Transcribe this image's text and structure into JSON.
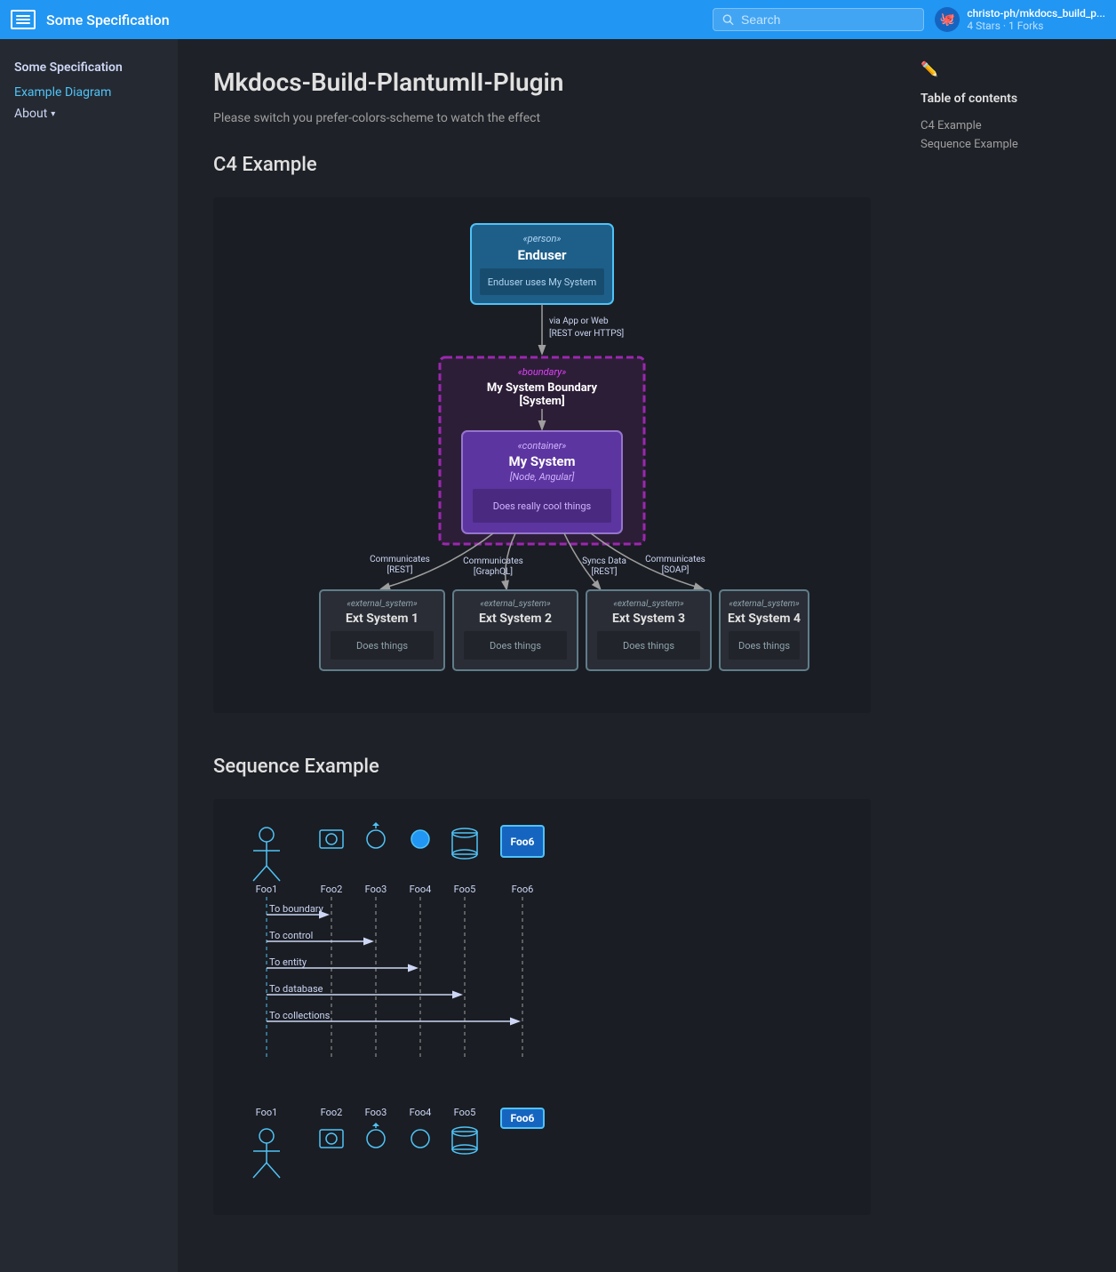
{
  "header": {
    "logo_label": "☰",
    "title": "Some Specification",
    "search_placeholder": "Search",
    "user": {
      "name": "christo-ph/mkdocs_build_p...",
      "meta": "4 Stars · 1 Forks",
      "icon": "🐙"
    }
  },
  "sidebar": {
    "title": "Some Specification",
    "links": [
      {
        "label": "Example Diagram",
        "active": true
      },
      {
        "label": "About",
        "has_chevron": true
      }
    ]
  },
  "toc": {
    "title": "Table of contents",
    "links": [
      {
        "label": "C4 Example"
      },
      {
        "label": "Sequence Example"
      }
    ]
  },
  "main": {
    "page_title": "Mkdocs-Build-PlantumlI-Plugin",
    "subtitle": "Please switch you prefer-colors-scheme to watch the effect",
    "c4_section": {
      "title": "C4 Example",
      "person": {
        "stereotype": "«person»",
        "name": "Enduser",
        "description": "Enduser uses My System"
      },
      "arrow_label": "via App or Web\n[REST over HTTPS]",
      "boundary": {
        "stereotype": "«boundary»",
        "name": "My System Boundary\n[System]"
      },
      "container": {
        "stereotype": "«container»",
        "name": "My System",
        "tech": "[Node, Angular]",
        "description": "Does really cool things"
      },
      "external_systems": [
        {
          "label": "Communicates\n[REST]",
          "stereotype": "«external_system»",
          "name": "Ext System 1",
          "description": "Does things"
        },
        {
          "label": "Communicates\n[GraphQL]",
          "stereotype": "«external_system»",
          "name": "Ext System 2",
          "description": "Does things"
        },
        {
          "label": "Syncs Data\n[REST]",
          "stereotype": "«external_system»",
          "name": "Ext System 3",
          "description": "Does things"
        },
        {
          "label": "Communicates\n[SOAP]",
          "stereotype": "«external_system»",
          "name": "Ext System 4",
          "description": "Does things"
        }
      ]
    },
    "sequence_section": {
      "title": "Sequence Example",
      "participants": [
        "Foo1",
        "Foo2",
        "Foo3",
        "Foo4",
        "Foo5",
        "Foo6"
      ],
      "arrows": [
        "To boundary",
        "To control",
        "To entity",
        "To database",
        "To collections"
      ]
    }
  }
}
